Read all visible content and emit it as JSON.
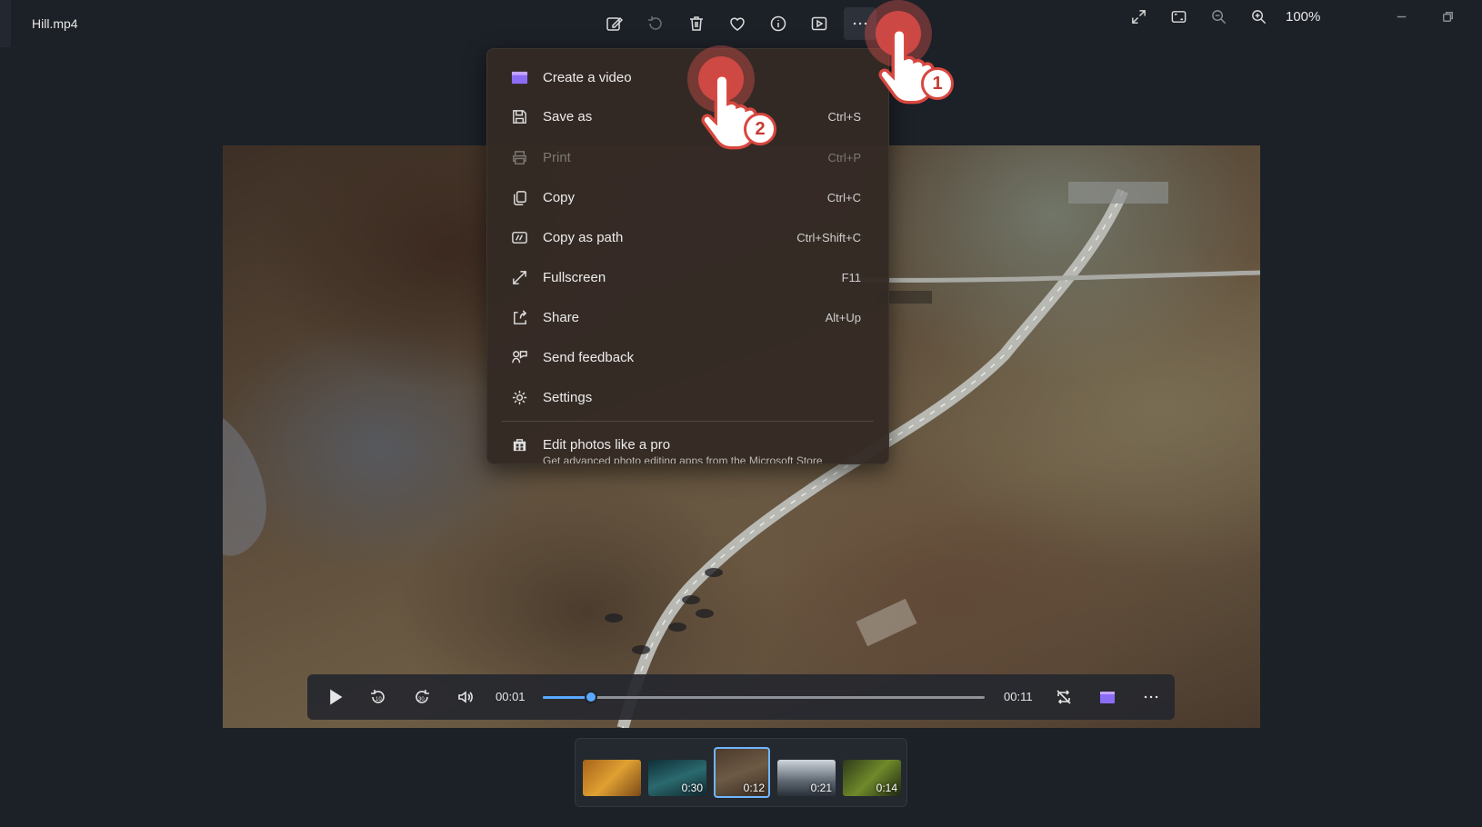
{
  "window": {
    "title": "Hill.mp4"
  },
  "toolbar": {
    "icons": [
      "edit-image-icon",
      "rotate-icon",
      "delete-icon",
      "favorite-heart-icon",
      "info-icon",
      "slideshow-icon",
      "more-options-icon"
    ]
  },
  "zoom": {
    "level": "100%"
  },
  "menu": {
    "items": [
      {
        "label": "Create a video",
        "shortcut": "",
        "icon": "clapperboard-icon",
        "disabled": false
      },
      {
        "label": "Save as",
        "shortcut": "Ctrl+S",
        "icon": "save-icon",
        "disabled": false
      },
      {
        "label": "Print",
        "shortcut": "Ctrl+P",
        "icon": "print-icon",
        "disabled": true
      },
      {
        "label": "Copy",
        "shortcut": "Ctrl+C",
        "icon": "copy-icon",
        "disabled": false
      },
      {
        "label": "Copy as path",
        "shortcut": "Ctrl+Shift+C",
        "icon": "copy-path-icon",
        "disabled": false
      },
      {
        "label": "Fullscreen",
        "shortcut": "F11",
        "icon": "fullscreen-icon",
        "disabled": false
      },
      {
        "label": "Share",
        "shortcut": "Alt+Up",
        "icon": "share-icon",
        "disabled": false
      },
      {
        "label": "Send feedback",
        "shortcut": "",
        "icon": "feedback-icon",
        "disabled": false
      },
      {
        "label": "Settings",
        "shortcut": "",
        "icon": "settings-gear-icon",
        "disabled": false
      }
    ],
    "promo": {
      "label": "Edit photos like a pro",
      "sublabel": "Get advanced photo editing apps from the Microsoft Store"
    }
  },
  "player": {
    "current_time": "00:01",
    "total_time": "00:11",
    "progress": 0.11,
    "accent": "#5aa9ff"
  },
  "filmstrip": {
    "thumbnails": [
      {
        "duration": "",
        "selected": false
      },
      {
        "duration": "0:30",
        "selected": false
      },
      {
        "duration": "0:12",
        "selected": true
      },
      {
        "duration": "0:21",
        "selected": false
      },
      {
        "duration": "0:14",
        "selected": false
      }
    ]
  },
  "annotations": {
    "step1": "1",
    "step2": "2",
    "color": "#d7473f"
  }
}
